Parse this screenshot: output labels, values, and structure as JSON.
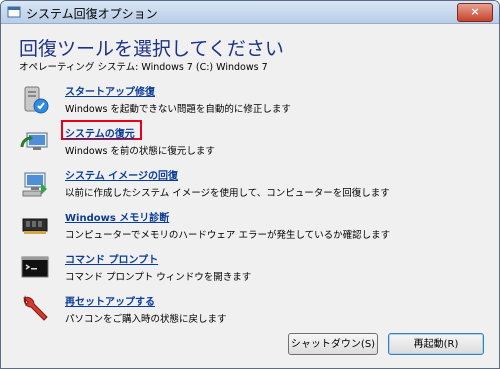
{
  "window": {
    "title": "システム回復オプション",
    "close_label": "×"
  },
  "heading": "回復ツールを選択してください",
  "os_line": "オペレーティング システム: Windows 7 (C:) Windows 7",
  "tools": [
    {
      "label": "スタートアップ修復",
      "description": "Windows を起動できない問題を自動的に修正します",
      "icon": "startup-repair-icon"
    },
    {
      "label": "システムの復元",
      "description": "Windows を前の状態に復元します",
      "icon": "system-restore-icon"
    },
    {
      "label": "システム イメージの回復",
      "description": "以前に作成したシステム イメージを使用して、コンピューターを回復します",
      "icon": "system-image-icon"
    },
    {
      "label": "Windows メモリ診断",
      "description": "コンピューターでメモリのハードウェア エラーが発生しているか確認します",
      "icon": "memory-chip-icon"
    },
    {
      "label": "コマンド プロンプト",
      "description": "コマンド プロンプト ウィンドウを開きます",
      "icon": "command-prompt-icon"
    },
    {
      "label": "再セットアップする",
      "description": "パソコンをご購入時の状態に戻します",
      "icon": "wrench-icon"
    }
  ],
  "buttons": {
    "shutdown": "シャットダウン(S)",
    "restart": "再起動(R)"
  },
  "highlight_color": "#e8001c"
}
